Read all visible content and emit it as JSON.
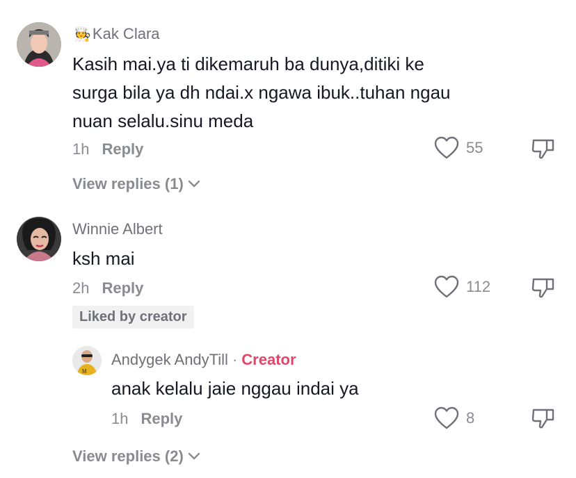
{
  "comments": [
    {
      "username": "Kak Clara",
      "badge_icon": "chef-emoji",
      "text_lines": [
        "Kasih mai.ya ti dikemaruh ba dunya,ditiki ke",
        "surga bila ya dh ndai.x ngawa ibuk..tuhan ngau",
        "nuan selalu.sinu meda"
      ],
      "time": "1h",
      "reply_label": "Reply",
      "likes": "55",
      "view_replies": "View replies (1)"
    },
    {
      "username": "Winnie Albert",
      "text_lines": [
        "ksh mai"
      ],
      "time": "2h",
      "reply_label": "Reply",
      "likes": "112",
      "liked_by_creator": "Liked by creator"
    }
  ],
  "reply": {
    "username": "Andygek AndyTill",
    "separator": "·",
    "creator_label": "Creator",
    "text": "anak kelalu jaie nggau indai ya",
    "time": "1h",
    "reply_label": "Reply",
    "likes": "8"
  },
  "footer": {
    "view_replies": "View replies (2)"
  },
  "colors": {
    "creator_accent": "#e1466a",
    "muted_text": "#8a8b91",
    "body_text": "#161823"
  }
}
